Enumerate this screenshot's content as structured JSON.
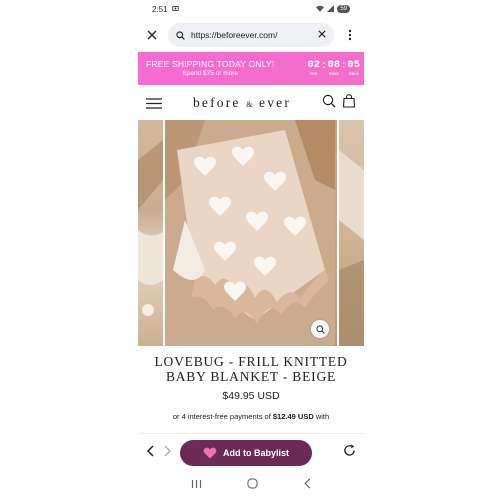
{
  "status_bar": {
    "time": "2:51",
    "battery": "59"
  },
  "browser": {
    "url": "https://beforeever.com/"
  },
  "promo": {
    "title": "FREE SHIPPING TODAY ONLY!",
    "subtitle": "Spend $75 or more",
    "timer": [
      {
        "value": "02",
        "label": "Hrs"
      },
      {
        "value": "08",
        "label": "Mins"
      },
      {
        "value": "05",
        "label": "Secs"
      }
    ],
    "color": "#f66ad3"
  },
  "site": {
    "logo_left": "before",
    "logo_amp": "&",
    "logo_right": "ever"
  },
  "product": {
    "title_line1": "LOVEBUG - FRILL KNITTED",
    "title_line2": "BABY BLANKET - BEIGE",
    "price": "$49.95 USD",
    "installments_prefix": "or 4 interest-free payments of ",
    "installments_amount": "$12.49 USD",
    "installments_suffix": " with"
  },
  "bottom_bar": {
    "babylist_label": "Add to Babylist",
    "button_color": "#6a2c56"
  }
}
